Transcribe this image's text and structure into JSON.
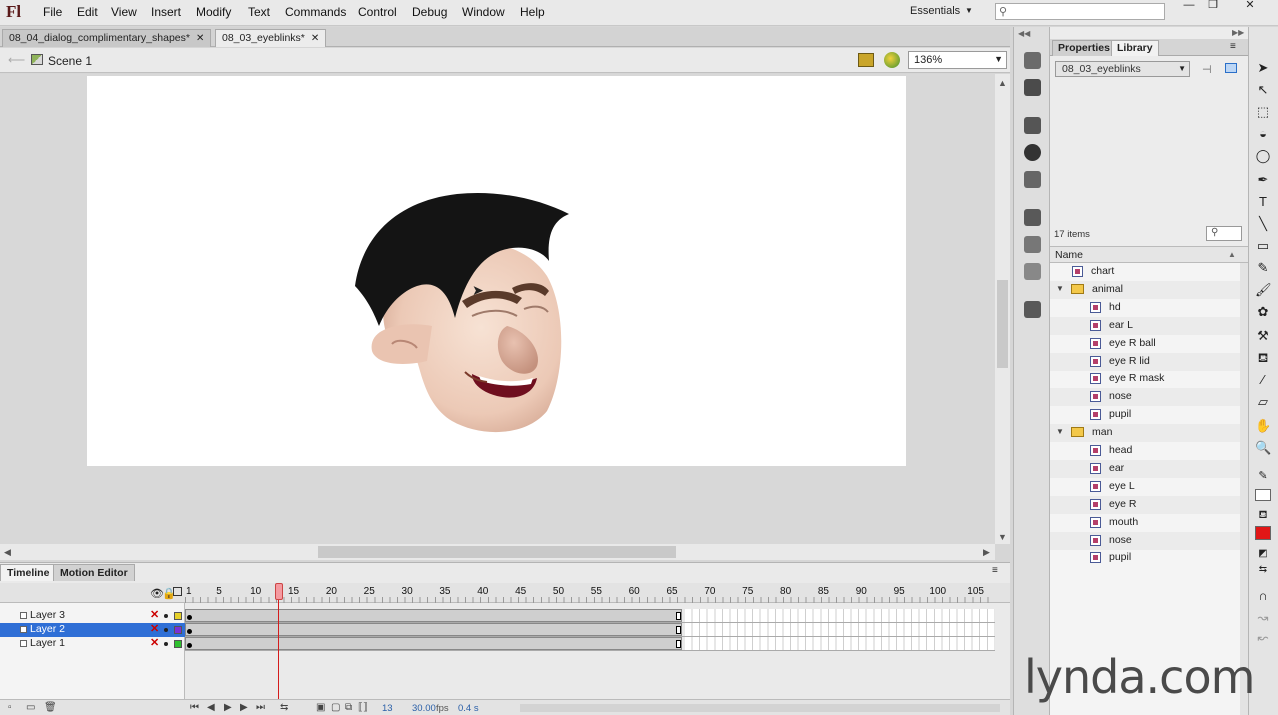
{
  "app": {
    "logo": "Fl"
  },
  "menu": [
    "File",
    "Edit",
    "View",
    "Insert",
    "Modify",
    "Text",
    "Commands",
    "Control",
    "Debug",
    "Window",
    "Help"
  ],
  "workspace": "Essentials",
  "window_controls": {
    "minimize": "—",
    "restore": "❐",
    "close": "✕"
  },
  "doc_tabs": [
    {
      "label": "08_04_dialog_complimentary_shapes*",
      "active": false
    },
    {
      "label": "08_03_eyeblinks*",
      "active": true
    }
  ],
  "edit_bar": {
    "scene": "Scene 1",
    "zoom": "136%"
  },
  "timeline": {
    "tabs": [
      "Timeline",
      "Motion Editor"
    ],
    "frame_numbers": [
      "1",
      "5",
      "10",
      "15",
      "20",
      "25",
      "30",
      "35",
      "40",
      "45",
      "50",
      "55",
      "60",
      "65",
      "70",
      "75",
      "80",
      "85",
      "90",
      "95",
      "100",
      "105"
    ],
    "layers": [
      {
        "name": "Layer 3",
        "selected": false,
        "color": "#e6d12a"
      },
      {
        "name": "Layer 2",
        "selected": true,
        "color": "#7a2fd6"
      },
      {
        "name": "Layer 1",
        "selected": false,
        "color": "#2fc12f"
      }
    ],
    "current_frame": "13",
    "fps": "30.00",
    "fps_unit": "fps",
    "elapsed": "0.4 s"
  },
  "library": {
    "tabs": [
      "Properties",
      "Library"
    ],
    "document": "08_03_eyeblinks",
    "item_count": "17 items",
    "column_name": "Name",
    "items": [
      {
        "name": "chart",
        "type": "symbol",
        "depth": 0
      },
      {
        "name": "animal",
        "type": "folder",
        "depth": 0
      },
      {
        "name": "hd",
        "type": "symbol",
        "depth": 1
      },
      {
        "name": "ear L",
        "type": "symbol",
        "depth": 1
      },
      {
        "name": "eye R ball",
        "type": "symbol",
        "depth": 1
      },
      {
        "name": "eye R lid",
        "type": "symbol",
        "depth": 1
      },
      {
        "name": "eye R mask",
        "type": "symbol",
        "depth": 1
      },
      {
        "name": "nose",
        "type": "symbol",
        "depth": 1
      },
      {
        "name": "pupil",
        "type": "symbol",
        "depth": 1
      },
      {
        "name": "man",
        "type": "folder",
        "depth": 0
      },
      {
        "name": "head",
        "type": "symbol",
        "depth": 1
      },
      {
        "name": "ear",
        "type": "symbol",
        "depth": 1
      },
      {
        "name": "eye L",
        "type": "symbol",
        "depth": 1
      },
      {
        "name": "eye R",
        "type": "symbol",
        "depth": 1
      },
      {
        "name": "mouth",
        "type": "symbol",
        "depth": 1
      },
      {
        "name": "nose",
        "type": "symbol",
        "depth": 1
      },
      {
        "name": "pupil",
        "type": "symbol",
        "depth": 1
      }
    ]
  },
  "colors": {
    "stroke": "#ffffff",
    "fill": "#e11616",
    "selection": "#2f6fd6",
    "playhead": "#d41c1c"
  },
  "watermark": "lynda.com"
}
